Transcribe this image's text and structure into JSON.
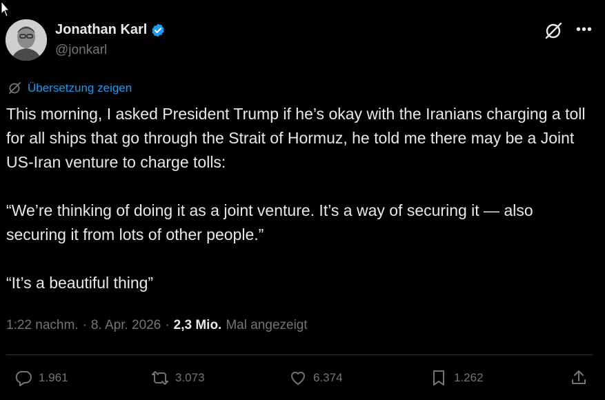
{
  "tweet": {
    "author_name": "Jonathan Karl",
    "author_handle": "@jonkarl",
    "translate_label": "Übersetzung zeigen",
    "text": "This morning, I asked President Trump if he’s okay with the Iranians charging a toll for all ships that go through the Strait of Hormuz, he told me there may be a Joint US-Iran venture to charge tolls:\n\n“We’re thinking of doing it as a joint venture. It’s a way of securing it — also securing it from lots of other people.”\n\n“It’s a beautiful thing”",
    "time": "1:22 nachm.",
    "date": "8. Apr. 2026",
    "views_count": "2,3 Mio.",
    "views_label": "Mal angezeigt",
    "separator": "·"
  },
  "actions": {
    "replies": "1.961",
    "reposts": "3.073",
    "likes": "6.374",
    "bookmarks": "1.262"
  },
  "icons": {
    "verified": "verified-badge-icon",
    "grok": "grok-icon",
    "more": "more-icon",
    "translate": "translate-icon",
    "reply": "reply-icon",
    "repost": "repost-icon",
    "like": "heart-icon",
    "bookmark": "bookmark-icon",
    "share": "share-icon",
    "cursor": "mouse-cursor-icon"
  },
  "colors": {
    "background": "#000000",
    "text": "#e7e9ea",
    "muted": "#71767b",
    "accent": "#1d9bf0",
    "divider": "#2f3336"
  }
}
